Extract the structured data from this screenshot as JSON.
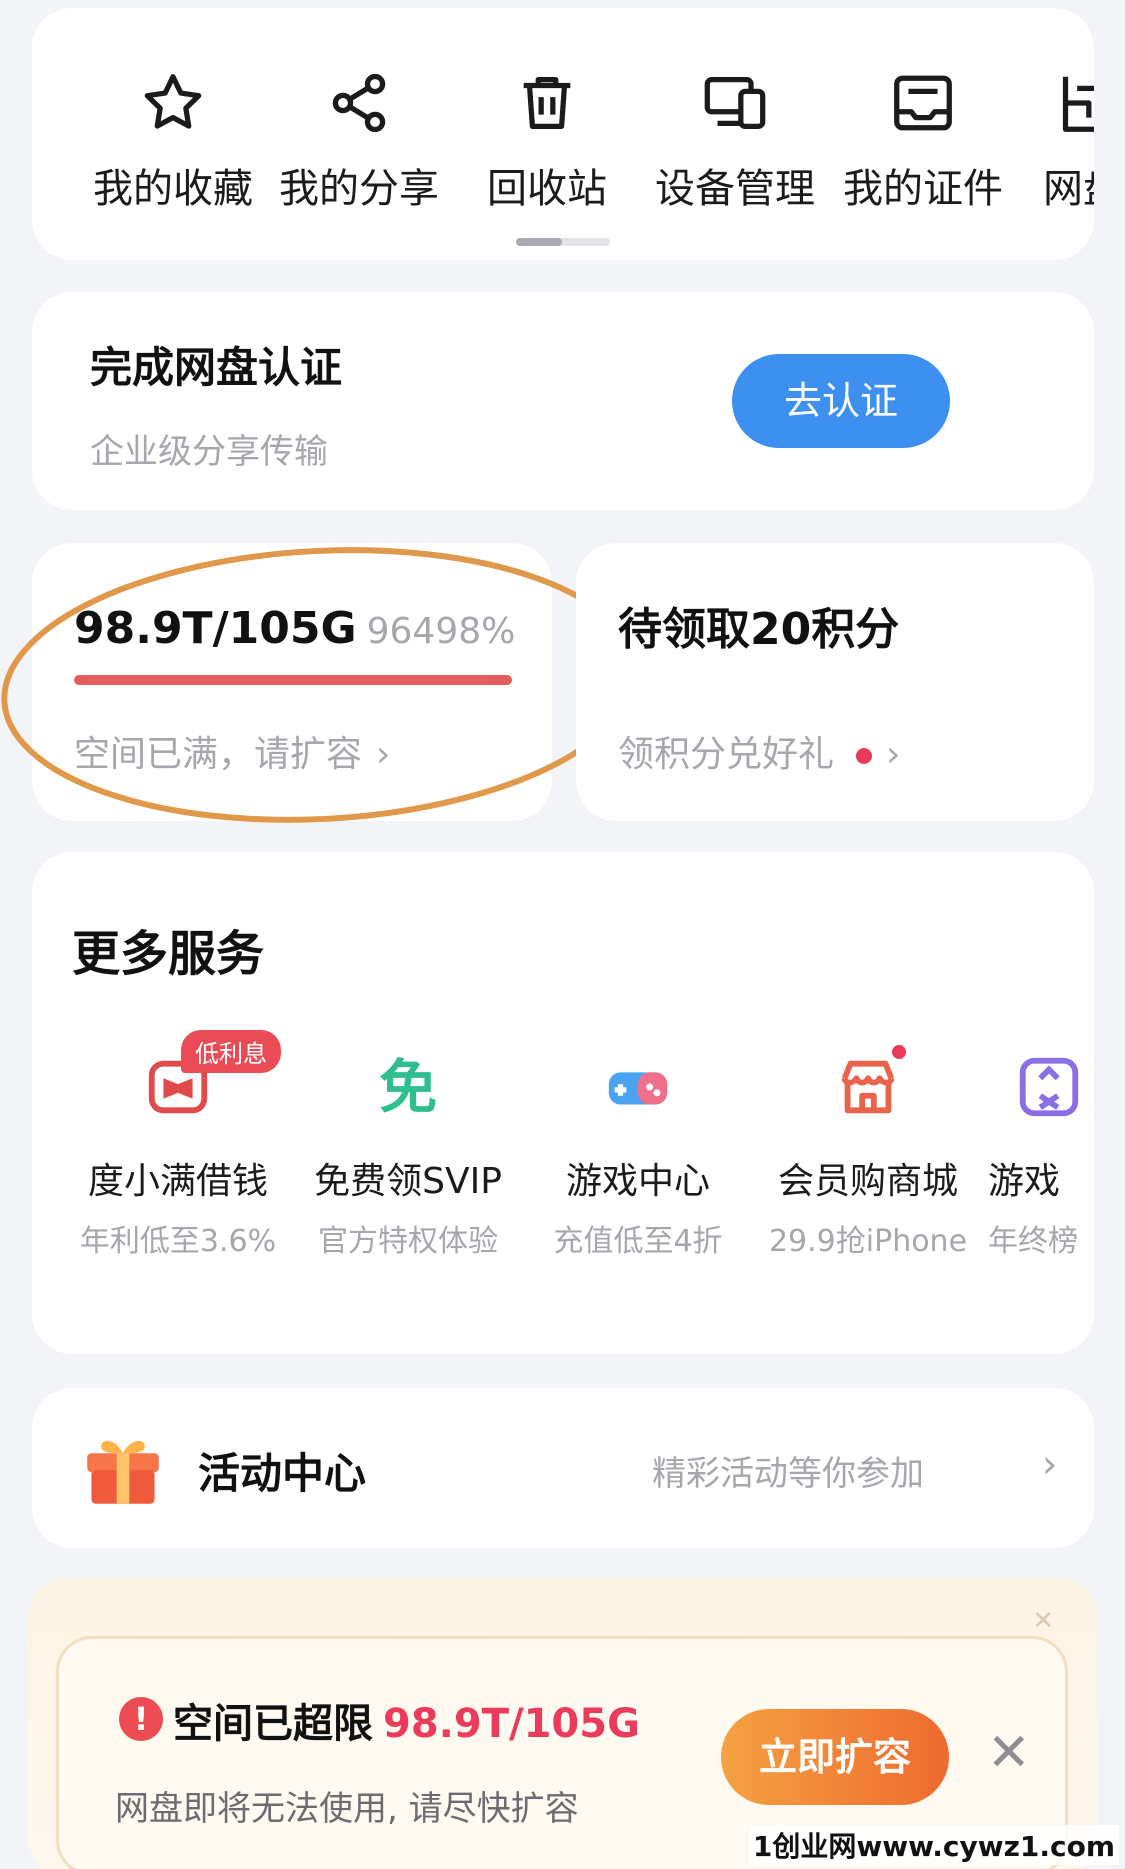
{
  "quick_actions": {
    "items": [
      {
        "label": "我的收藏",
        "icon": "star-icon"
      },
      {
        "label": "我的分享",
        "icon": "share-icon"
      },
      {
        "label": "回收站",
        "icon": "trash-icon"
      },
      {
        "label": "设备管理",
        "icon": "devices-icon"
      },
      {
        "label": "我的证件",
        "icon": "id-card-icon"
      },
      {
        "label": "网盘",
        "icon": "cloud-drive-icon"
      }
    ],
    "page_indicator": {
      "pages": 2,
      "current": 1
    }
  },
  "verify_card": {
    "title": "完成网盘认证",
    "subtitle": "企业级分享传输",
    "button_label": "去认证",
    "button_color": "#3d8ff0"
  },
  "storage_card": {
    "usage": "98.9T/105G",
    "percent": "96498%",
    "usage_fraction": 1.0,
    "action_label": "空间已满，请扩容",
    "bar_color": "#e25d5d",
    "highlight_color": "#e0984a"
  },
  "points_card": {
    "title": "待领取20积分",
    "action_label": "领积分兑好礼"
  },
  "services": {
    "title": "更多服务",
    "items": [
      {
        "name": "度小满借钱",
        "desc": "年利低至3.6%",
        "icon": "du-xiaoman-icon",
        "badge": "低利息"
      },
      {
        "name": "免费领SVIP",
        "desc": "官方特权体验",
        "icon": "free-svip-icon",
        "icon_text": "免"
      },
      {
        "name": "游戏中心",
        "desc": "充值低至4折",
        "icon": "gamepad-icon"
      },
      {
        "name": "会员购商城",
        "desc": "29.9抢iPhone",
        "icon": "store-icon"
      },
      {
        "name": "游戏",
        "desc": "年终榜",
        "icon": "game-icon"
      }
    ]
  },
  "activity": {
    "title": "活动中心",
    "subtitle": "精彩活动等你参加"
  },
  "alert_banner": {
    "title": "空间已超限",
    "usage": "98.9T/105G",
    "subtitle": "网盘即将无法使用, 请尽快扩容",
    "button_label": "立即扩容"
  },
  "watermark": "1创业网www.cywz1.com"
}
